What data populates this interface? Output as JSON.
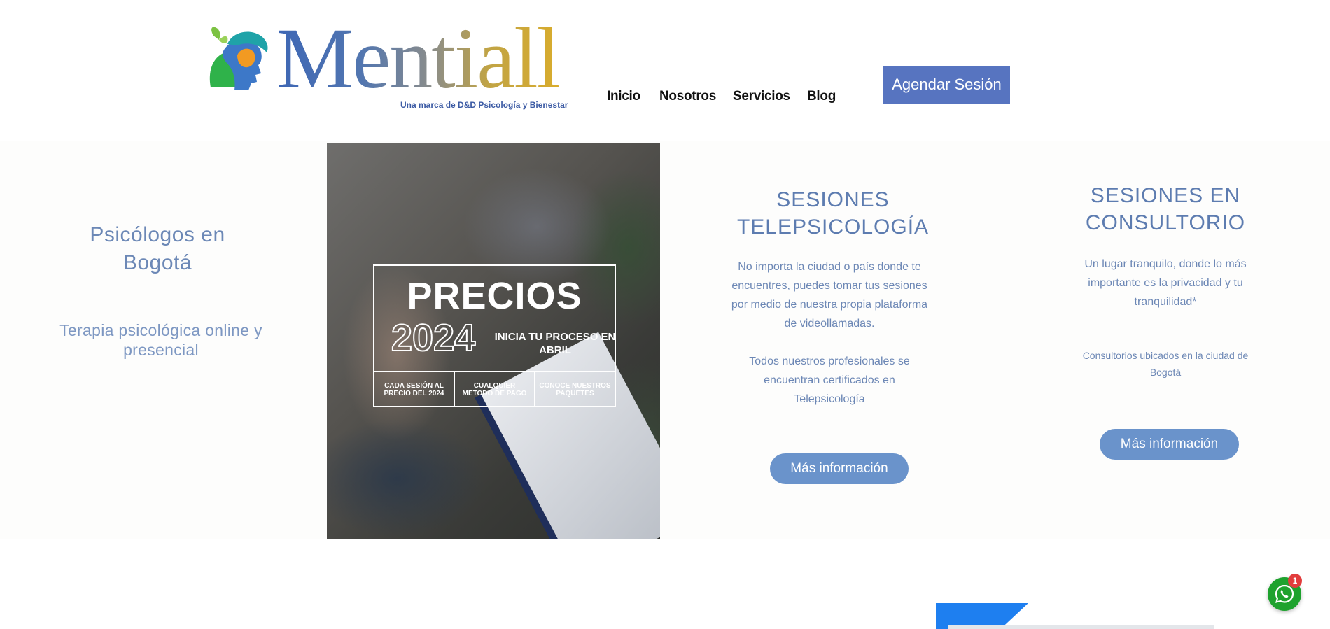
{
  "brand": {
    "name": "Mentiall",
    "tagline": "Una marca de D&D Psicología y Bienestar",
    "colors": {
      "blue": "#3e67b5",
      "gold": "#d9ac2c",
      "green": "#2fb24a"
    }
  },
  "nav": {
    "items": [
      "Inicio",
      "Nosotros",
      "Servicios",
      "Blog"
    ],
    "cta": "Agendar Sesión"
  },
  "hero": {
    "title": "Psicólogos en Bogotá",
    "subtitle": "Terapia psicológica online y presencial"
  },
  "promo": {
    "title": "PRECIOS",
    "year": "2024",
    "cta": "INICIA TU PROCESO EN ABRIL",
    "cells": [
      "CADA SESIÓN AL PRECIO DEL 2024",
      "CUALQUIER METODO DE PAGO",
      "CONOCE NUESTROS PAQUETES"
    ]
  },
  "services": [
    {
      "title": "SESIONES TELEPSICOLOGÍA",
      "text1": "No importa la ciudad o país  donde te encuentres, puedes tomar tus sesiones por medio de nuestra propia plataforma de videollamadas.",
      "text2": "Todos nuestros profesionales se encuentran certificados en Telepsicología",
      "button": "Más información"
    },
    {
      "title": "SESIONES EN CONSULTORIO",
      "text1": "Un lugar tranquilo, donde lo más importante es la privacidad y tu tranquilidad*",
      "text2": "Consultorios ubicados en la ciudad de Bogotá",
      "button": "Más información"
    }
  ],
  "whatsapp": {
    "icon": "whatsapp-icon",
    "badge": "1",
    "color": "#1ea22e"
  }
}
